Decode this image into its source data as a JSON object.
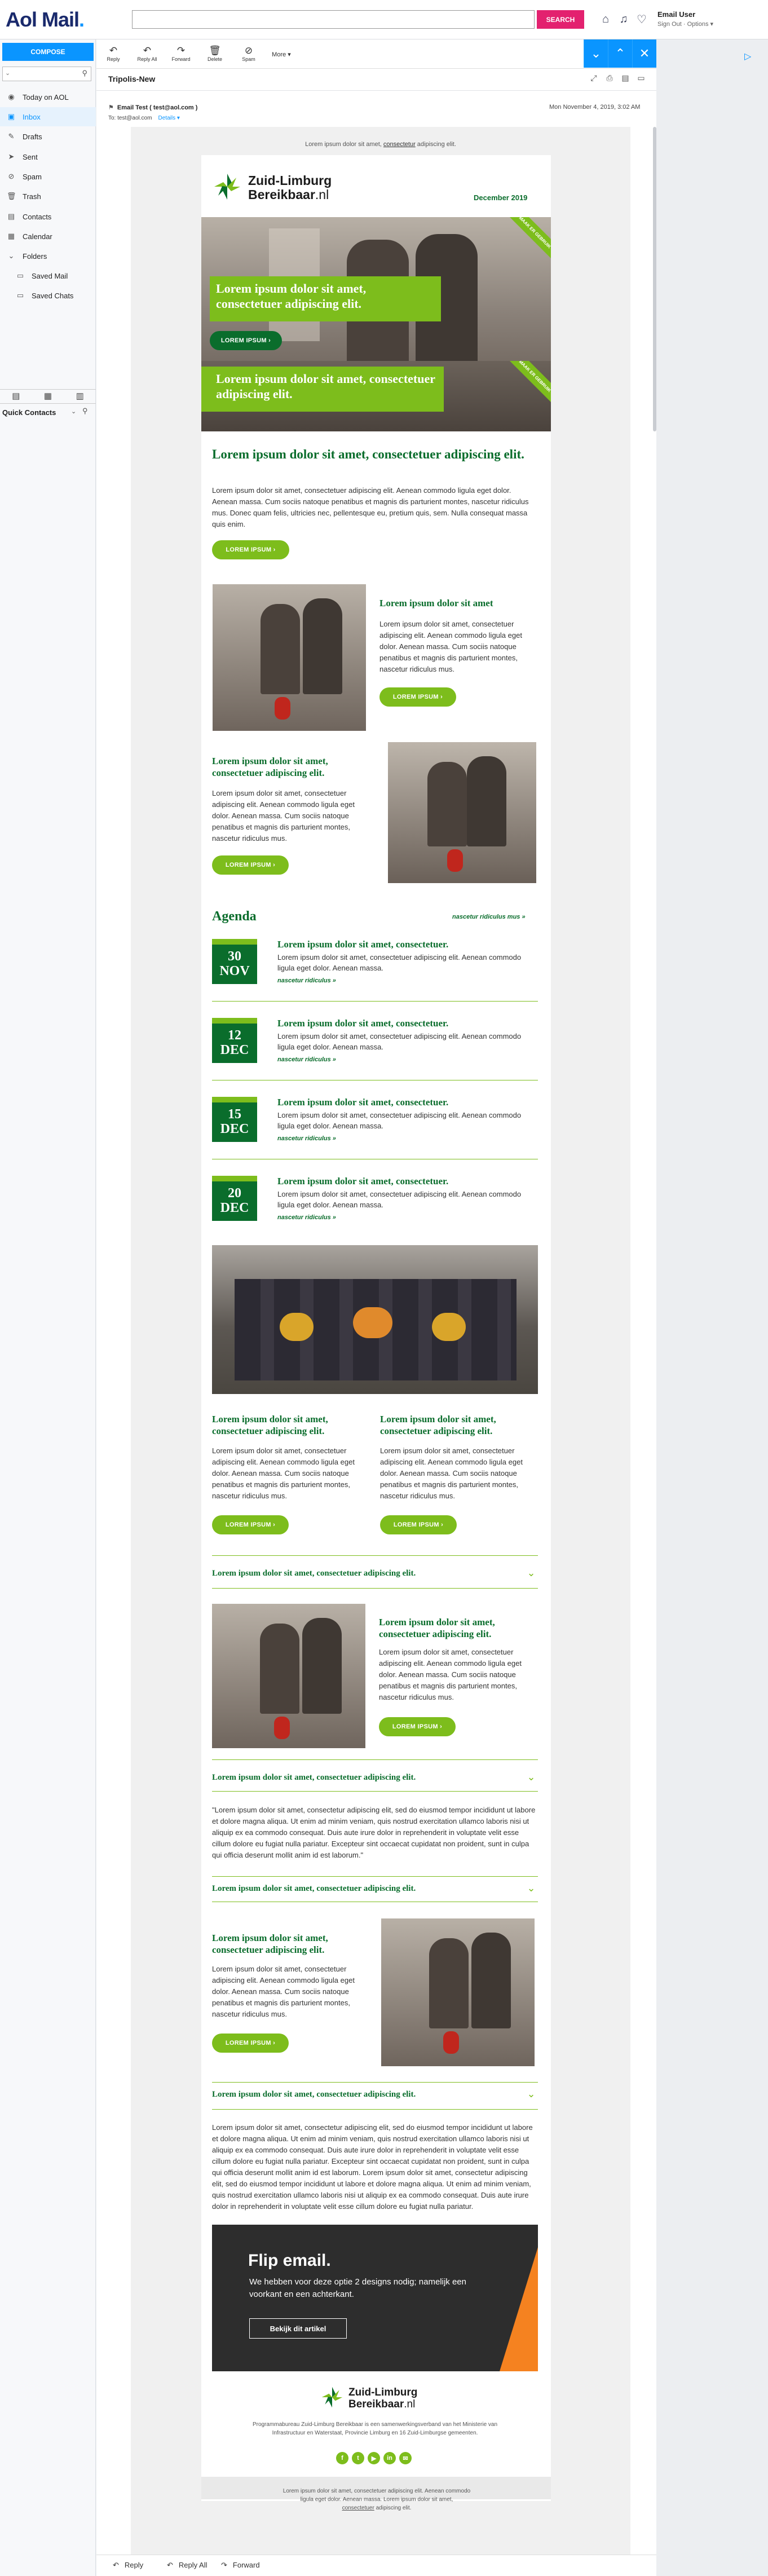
{
  "app": {
    "logo_main": "Aol",
    "logo_rest": " Mail",
    "logo_dot": ".",
    "search_button": "SEARCH",
    "user_name": "Email User",
    "user_links": "Sign Out · Options ▾"
  },
  "sidebar": {
    "compose": "COMPOSE",
    "items": [
      {
        "label": "Today on AOL",
        "icon": "aol-icon"
      },
      {
        "label": "Inbox",
        "icon": "inbox-icon"
      },
      {
        "label": "Drafts",
        "icon": "drafts-icon"
      },
      {
        "label": "Sent",
        "icon": "sent-icon"
      },
      {
        "label": "Spam",
        "icon": "spam-icon"
      },
      {
        "label": "Trash",
        "icon": "trash-icon"
      },
      {
        "label": "Contacts",
        "icon": "contacts-icon"
      },
      {
        "label": "Calendar",
        "icon": "calendar-icon"
      },
      {
        "label": "Folders",
        "icon": "folder-icon"
      },
      {
        "label": "Saved Mail",
        "icon": "folder-icon"
      },
      {
        "label": "Saved Chats",
        "icon": "folder-icon"
      }
    ],
    "quick_contacts": "Quick Contacts"
  },
  "toolbar": {
    "reply": "Reply",
    "reply_all": "Reply All",
    "forward": "Forward",
    "delete": "Delete",
    "spam": "Spam",
    "more": "More ▾"
  },
  "message": {
    "subject": "Tripolis-New",
    "from": "Email Test ( test@aol.com )",
    "to": "To:  test@aol.com",
    "details": "Details ▾",
    "date": "Mon November 4, 2019, 3:02 AM"
  },
  "email": {
    "preheader_pre": "Lorem ipsum dolor sit amet, ",
    "preheader_link": "consectetur",
    "preheader_post": " adipiscing elit.",
    "brand_line1": "Zuid-Limburg",
    "brand_line2a": "Bereikbaar",
    "brand_line2b": ".nl",
    "issue_date": "December 2019",
    "hero_title": "Lorem ipsum dolor sit amet, consectetuer adipiscing elit.",
    "hero_button": "LOREM IPSUM ›",
    "hero_ribbon": "MAAK ER GEBRUIK VAN",
    "banner_title": "Lorem ipsum dolor sit amet, consectetuer adipiscing elit.",
    "banner_ribbon": "MAAK ER GEBRUIK VAN",
    "intro_title": "Lorem ipsum dolor sit amet, consectetuer adipiscing elit.",
    "intro_text": "Lorem ipsum dolor sit amet, consectetuer adipiscing elit. Aenean commodo ligula eget dolor. Aenean massa. Cum sociis natoque penatibus et magnis dis parturient montes, nascetur ridiculus mus. Donec quam felis, ultricies nec, pellentesque eu, pretium quis, sem. Nulla consequat massa quis enim.",
    "intro_button": "LOREM IPSUM ›",
    "feat1_title": "Lorem ipsum dolor sit amet",
    "feat1_text": "Lorem ipsum dolor sit amet, consectetuer adipiscing elit. Aenean commodo ligula eget dolor. Aenean massa. Cum sociis natoque penatibus et magnis dis parturient montes, nascetur ridiculus mus.",
    "feat1_button": "LOREM IPSUM ›",
    "feat2_title": "Lorem ipsum dolor sit amet, consectetuer adipiscing elit.",
    "feat2_text": "Lorem ipsum dolor sit amet, consectetuer adipiscing elit. Aenean commodo ligula eget dolor. Aenean massa. Cum sociis natoque penatibus et magnis dis parturient montes, nascetur ridiculus mus.",
    "feat2_button": "LOREM IPSUM ›",
    "agenda_title": "Agenda",
    "agenda_link": "nascetur ridiculus mus »",
    "agenda": [
      {
        "day": "30",
        "month": "NOV",
        "title": "Lorem ipsum dolor sit amet, consectetuer.",
        "text": "Lorem ipsum dolor sit amet, consectetuer adipiscing elit. Aenean commodo ligula eget dolor. Aenean massa.",
        "link": "nascetur ridiculus »"
      },
      {
        "day": "12",
        "month": "DEC",
        "title": "Lorem ipsum dolor sit amet, consectetuer.",
        "text": "Lorem ipsum dolor sit amet, consectetuer adipiscing elit. Aenean commodo ligula eget dolor. Aenean massa.",
        "link": "nascetur ridiculus »"
      },
      {
        "day": "15",
        "month": "DEC",
        "title": "Lorem ipsum dolor sit amet, consectetuer.",
        "text": "Lorem ipsum dolor sit amet, consectetuer adipiscing elit. Aenean commodo ligula eget dolor. Aenean massa.",
        "link": "nascetur ridiculus »"
      },
      {
        "day": "20",
        "month": "DEC",
        "title": "Lorem ipsum dolor sit amet, consectetuer.",
        "text": "Lorem ipsum dolor sit amet, consectetuer adipiscing elit. Aenean commodo ligula eget dolor. Aenean massa.",
        "link": "nascetur ridiculus »"
      }
    ],
    "col1_title": "Lorem ipsum dolor sit amet, consectetuer adipiscing elit.",
    "col1_text": "Lorem ipsum dolor sit amet, consectetuer adipiscing elit. Aenean commodo ligula eget dolor. Aenean massa. Cum sociis natoque penatibus et magnis dis parturient montes, nascetur ridiculus mus.",
    "col1_button": "LOREM IPSUM ›",
    "col2_title": "Lorem ipsum dolor sit amet, consectetuer adipiscing elit.",
    "col2_text": "Lorem ipsum dolor sit amet, consectetuer adipiscing elit. Aenean commodo ligula eget dolor. Aenean massa. Cum sociis natoque penatibus et magnis dis parturient montes, nascetur ridiculus mus.",
    "col2_button": "LOREM IPSUM ›",
    "acc1_title": "Lorem ipsum dolor sit amet, consectetuer adipiscing elit.",
    "acc1_feat_title": "Lorem ipsum dolor sit amet, consectetuer adipiscing elit.",
    "acc1_feat_text": "Lorem ipsum dolor sit amet, consectetuer adipiscing elit. Aenean commodo ligula eget dolor. Aenean massa. Cum sociis natoque penatibus et magnis dis parturient montes, nascetur ridiculus mus.",
    "acc1_button": "LOREM IPSUM ›",
    "acc2_title": "Lorem ipsum dolor sit amet, consectetuer adipiscing elit.",
    "acc2_quote": "\"Lorem ipsum dolor sit amet, consectetur adipiscing elit, sed do eiusmod tempor incididunt ut labore et dolore magna aliqua. Ut enim ad minim veniam, quis nostrud exercitation ullamco laboris nisi ut aliquip ex ea commodo consequat. Duis aute irure dolor in reprehenderit in voluptate velit esse cillum dolore eu fugiat nulla pariatur. Excepteur sint occaecat cupidatat non proident, sunt in culpa qui officia deserunt mollit anim id est laborum.\"",
    "acc3_title": "Lorem ipsum dolor sit amet, consectetuer adipiscing elit.",
    "acc3_feat_title": "Lorem ipsum dolor sit amet, consectetuer adipiscing elit.",
    "acc3_feat_text": "Lorem ipsum dolor sit amet, consectetuer adipiscing elit. Aenean commodo ligula eget dolor. Aenean massa. Cum sociis natoque penatibus et magnis dis parturient montes, nascetur ridiculus mus.",
    "acc3_button": "LOREM IPSUM ›",
    "acc4_title": "Lorem ipsum dolor sit amet, consectetuer adipiscing elit.",
    "acc4_text": "Lorem ipsum dolor sit amet, consectetur adipiscing elit, sed do eiusmod tempor incididunt ut labore et dolore magna aliqua. Ut enim ad minim veniam, quis nostrud exercitation ullamco laboris nisi ut aliquip ex ea commodo consequat. Duis aute irure dolor in reprehenderit in voluptate velit esse cillum dolore eu fugiat nulla pariatur. Excepteur sint occaecat cupidatat non proident, sunt in culpa qui officia deserunt mollit anim id est laborum. Lorem ipsum dolor sit amet, consectetur adipiscing elit, sed do eiusmod tempor incididunt ut labore et dolore magna aliqua. Ut enim ad minim veniam, quis nostrud exercitation ullamco laboris nisi ut aliquip ex ea commodo consequat. Duis aute irure dolor in reprehenderit in voluptate velit esse cillum dolore eu fugiat nulla pariatur.",
    "flip_title": "Flip email.",
    "flip_text": "We hebben voor deze optie 2 designs nodig; namelijk een voorkant en een achterkant.",
    "flip_button": "Bekijk dit artikel",
    "footer_text": "Programmabureau Zuid-Limburg Bereikbaar is een samenwerkingsverband van het Ministerie van Infrastructuur en Waterstaat, Provincie Limburg en 16 Zuid-Limburgse gemeenten.",
    "social": [
      "f",
      "t",
      "▶",
      "in",
      "✉"
    ],
    "unsub_line1": "Lorem ipsum dolor sit amet, consectetuer adipiscing elit. Aenean commodo",
    "unsub_line2": "ligula eget dolor. Aenean massa. Lorem ipsum dolor sit amet,",
    "unsub_link": "consectetuer",
    "unsub_post": " adipiscing elit."
  },
  "replybar": {
    "reply": "Reply",
    "reply_all": "Reply All",
    "forward": "Forward"
  },
  "colors": {
    "brand_green": "#0a6d2c",
    "lime": "#7dbd1c",
    "aol_blue": "#0a95ff",
    "search_pink": "#e3216f"
  }
}
